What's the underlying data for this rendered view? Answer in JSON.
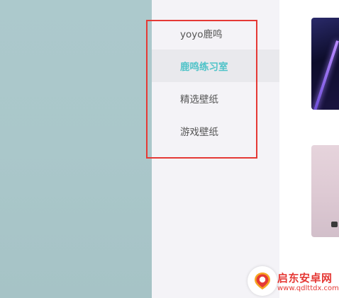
{
  "sidebar": {
    "items": [
      {
        "label": "yoyo鹿鸣",
        "active": false
      },
      {
        "label": "鹿鸣练习室",
        "active": true
      },
      {
        "label": "精选壁纸",
        "active": false
      },
      {
        "label": "游戏壁纸",
        "active": false
      }
    ]
  },
  "watermark": {
    "title": "启东安卓网",
    "url": "www.qdlttdx.com"
  },
  "colors": {
    "accent": "#4fc3c8",
    "highlight_border": "#e53935",
    "sidebar_bg": "#f4f3f7",
    "left_panel_bg": "#acc9cc"
  }
}
